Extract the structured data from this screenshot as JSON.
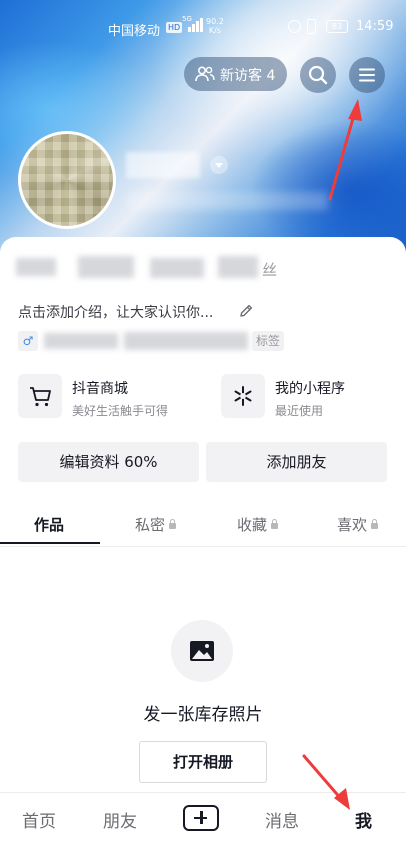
{
  "status_bar": {
    "carrier": "中国移动",
    "network_badge": "HD",
    "signal_label": "5G",
    "speed_value": "90.2",
    "speed_unit": "K/s",
    "battery": "83",
    "time": "14:59"
  },
  "header": {
    "visitor_label": "新访客 4"
  },
  "profile": {
    "stats_tail": "丝",
    "intro": "点击添加介绍，让大家认识你...",
    "tag_tail": "标签"
  },
  "features": [
    {
      "title": "抖音商城",
      "subtitle": "美好生活触手可得"
    },
    {
      "title": "我的小程序",
      "subtitle": "最近使用"
    }
  ],
  "actions": {
    "edit_profile": "编辑资料 60%",
    "add_friends": "添加朋友"
  },
  "tabs": [
    {
      "label": "作品"
    },
    {
      "label": "私密"
    },
    {
      "label": "收藏"
    },
    {
      "label": "喜欢"
    }
  ],
  "empty_state": {
    "message": "发一张库存照片",
    "button": "打开相册"
  },
  "bottom_nav": [
    {
      "label": "首页"
    },
    {
      "label": "朋友"
    },
    {
      "label": "消息"
    },
    {
      "label": "我"
    }
  ],
  "colors": {
    "annotation_arrow": "#ee3b3b",
    "text_primary": "#161823",
    "gender_icon": "#3a8ee8"
  }
}
